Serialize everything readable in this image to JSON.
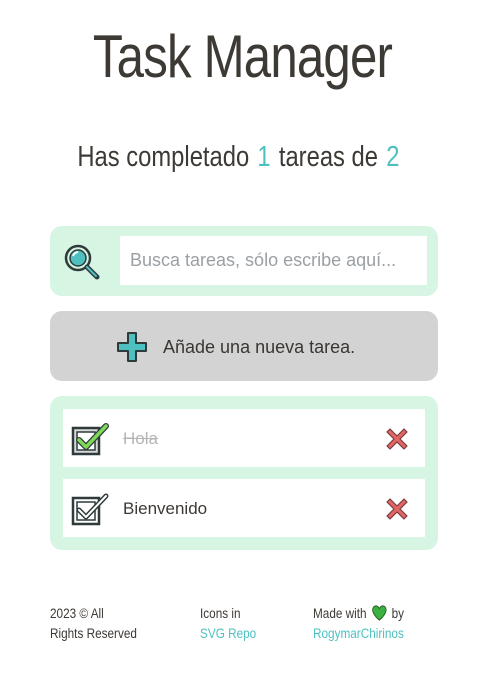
{
  "header": {
    "title": "Task Manager"
  },
  "counter": {
    "prefix": "Has completado",
    "completed": "1",
    "middle": "tareas de",
    "total": "2"
  },
  "search": {
    "placeholder": "Busca tareas, sólo escribe aquí...",
    "value": ""
  },
  "add_button": {
    "label": "Añade una nueva tarea."
  },
  "tasks": [
    {
      "text": "Hola",
      "completed": true
    },
    {
      "text": "Bienvenido",
      "completed": false
    }
  ],
  "footer": {
    "copyright_line1": "2023 © All",
    "copyright_line2": "Rights Reserved",
    "icons_text": "Icons in",
    "icons_link": "SVG Repo",
    "made_text": "Made with",
    "made_by": "by",
    "author_link": "RogymarChirinos"
  },
  "colors": {
    "accent": "#4fc0c0",
    "panel": "#d6f5e3",
    "add_button": "#d3d3d3",
    "delete": "#e06666",
    "heart": "#3cb043"
  }
}
